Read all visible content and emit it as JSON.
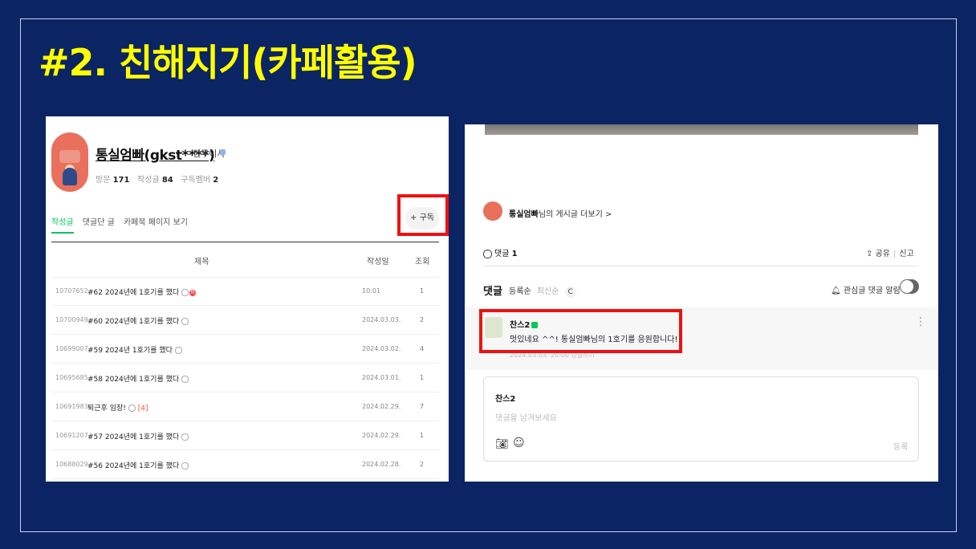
{
  "slide": {
    "title": "#2. 친해지기(카페활용)"
  },
  "left_panel": {
    "nickname": "통실엄빠(gkst****)",
    "rank": "전무이사",
    "stats": {
      "visit_label": "방문",
      "visit": "171",
      "posts_label": "작성글",
      "posts": "84",
      "subs_label": "구독멤버",
      "subs": "2"
    },
    "tabs": [
      "작성글",
      "댓글단 글",
      "카페북 페이지 보기"
    ],
    "subscribe_button": "+ 구독",
    "table": {
      "headers": {
        "title": "제목",
        "date": "작성일",
        "views": "조회"
      },
      "rows": [
        {
          "id": "10707652",
          "title": "#62 2024년에 1호기를 했다",
          "date": "10:01",
          "views": "1"
        },
        {
          "id": "10700949",
          "title": "#60 2024년에 1호기를 했다",
          "date": "2024.03.03.",
          "views": "2"
        },
        {
          "id": "10699007",
          "title": "#59 2024년 1호기를 했다",
          "date": "2024.03.02.",
          "views": "4"
        },
        {
          "id": "10695685",
          "title": "#58 2024년에 1호기를 했다",
          "date": "2024.03.01.",
          "views": "1"
        },
        {
          "id": "10691983",
          "title": "퇴근후 임장!",
          "comments": "[4]",
          "date": "2024.02.29.",
          "views": "7"
        },
        {
          "id": "10691207",
          "title": "#57 2024년에 1호기를 했다",
          "date": "2024.02.29.",
          "views": "1"
        },
        {
          "id": "10688029",
          "title": "#56 2024년에 1호기를 했다",
          "date": "2024.02.28.",
          "views": "2"
        }
      ]
    }
  },
  "right_panel": {
    "author": "통실엄빠",
    "more_posts_suffix": "님의 게시글 더보기 >",
    "comment_count_label": "댓글",
    "comment_count": "1",
    "share": "공유",
    "report": "신고",
    "comments_heading": "댓글",
    "sort_options": [
      "등록순",
      "최신순"
    ],
    "refresh_icon": "C",
    "alarm_label": "관심글 댓글 알림",
    "comment": {
      "author": "찬스2",
      "text": "멋있네요 ^^! 통실엄빠님의 1호기를 응원합니다!",
      "meta": "2024.03.03. 20:00   답글쓰기"
    },
    "write": {
      "name": "찬스2",
      "placeholder": "댓글을 남겨보세요",
      "submit": "등록"
    }
  },
  "colors": {
    "background": "#0b2463",
    "title": "#ffff00",
    "highlight": "#ee1111",
    "accent_green": "#03c75a"
  }
}
